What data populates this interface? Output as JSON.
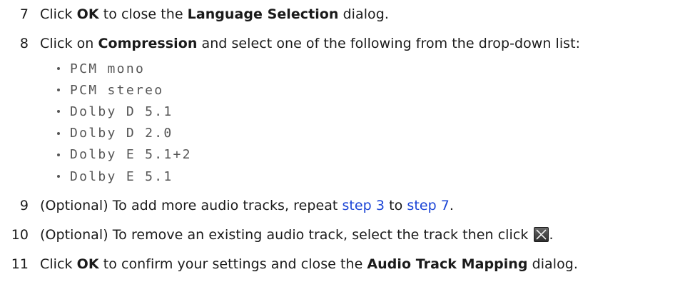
{
  "steps": {
    "s7": {
      "number": "7",
      "pre": "Click ",
      "b1": "OK",
      "mid": " to close the ",
      "b2": "Language Selection",
      "post": " dialog."
    },
    "s8": {
      "number": "8",
      "pre": "Click on ",
      "b1": "Compression",
      "post": " and select one of the following from the drop-down list:"
    },
    "s9": {
      "number": "9",
      "pre": "(Optional) To add more audio tracks, repeat ",
      "link1": "step 3",
      "mid": " to ",
      "link2": "step 7",
      "post": "."
    },
    "s10": {
      "number": "10",
      "text": "(Optional) To remove an existing audio track, select the track then click ",
      "post": ".",
      "icon": "remove-track-icon"
    },
    "s11": {
      "number": "11",
      "pre": "Click ",
      "b1": "OK",
      "mid": " to confirm your settings and close the ",
      "b2": "Audio Track Mapping",
      "post": " dialog."
    }
  },
  "compression_options": [
    "PCM mono",
    "PCM stereo",
    "Dolby D 5.1",
    "Dolby D 2.0",
    "Dolby E 5.1+2",
    "Dolby E 5.1"
  ],
  "colors": {
    "link": "#1a44d6",
    "text": "#1a1a1a",
    "mono": "#555555"
  }
}
